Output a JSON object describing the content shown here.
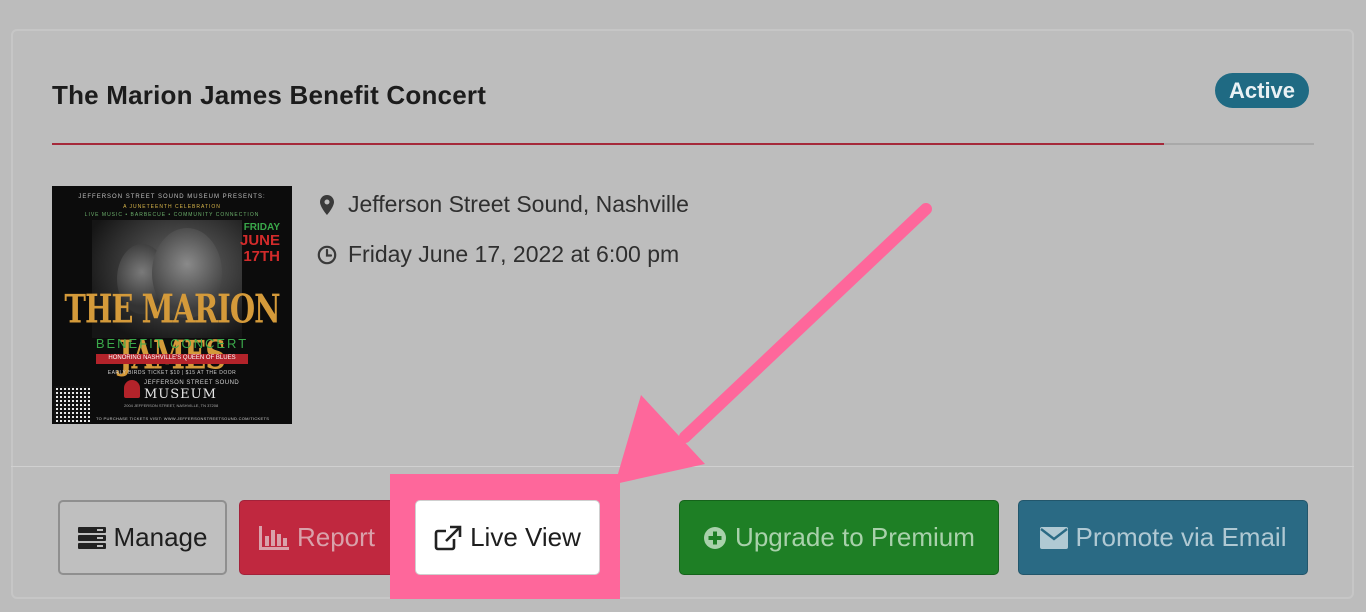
{
  "event": {
    "title": "The Marion James Benefit Concert",
    "status": "Active",
    "location": "Jefferson Street Sound, Nashville",
    "datetime": "Friday June 17, 2022 at 6:00 pm"
  },
  "poster": {
    "presenter": "JEFFERSON STREET SOUND MUSEUM PRESENTS:",
    "celebration": "A JUNETEENTH CELEBRATION",
    "tagline": "LIVE MUSIC • BARBECUE • COMMUNITY CONNECTION",
    "day": "FRIDAY",
    "month": "JUNE",
    "date": "17TH",
    "headline": "THE MARION JAMES",
    "subheadline": "BENEFIT CONCERT",
    "honoring": "HONORING NASHVILLE'S QUEEN OF BLUES",
    "tickets": "EARLY BIRDS TICKET $10  |  $15 AT THE DOOR",
    "museum_top": "JEFFERSON STREET SOUND",
    "museum_name": "MUSEUM",
    "address": "2004 JEFFERSON STREET, NASHVILLE, TN 37208",
    "purchase": "TO PURCHASE TICKETS VISIT: WWW.JEFFERSONSTREETSOUND.COM/TICKETS"
  },
  "actions": {
    "manage": "Manage",
    "report": "Report",
    "live_view": "Live View",
    "upgrade": "Upgrade to Premium",
    "promote": "Promote via Email"
  },
  "colors": {
    "highlight": "#fe679b",
    "active_badge": "#1f6a83",
    "report": "#c0283f",
    "premium": "#1e7f25",
    "email": "#2a6a84"
  },
  "icons": {
    "location": "map-marker-icon",
    "time": "clock-icon",
    "manage": "server-icon",
    "report": "bar-chart-icon",
    "live_view": "external-link-icon",
    "upgrade": "plus-circle-icon",
    "promote": "envelope-icon"
  }
}
